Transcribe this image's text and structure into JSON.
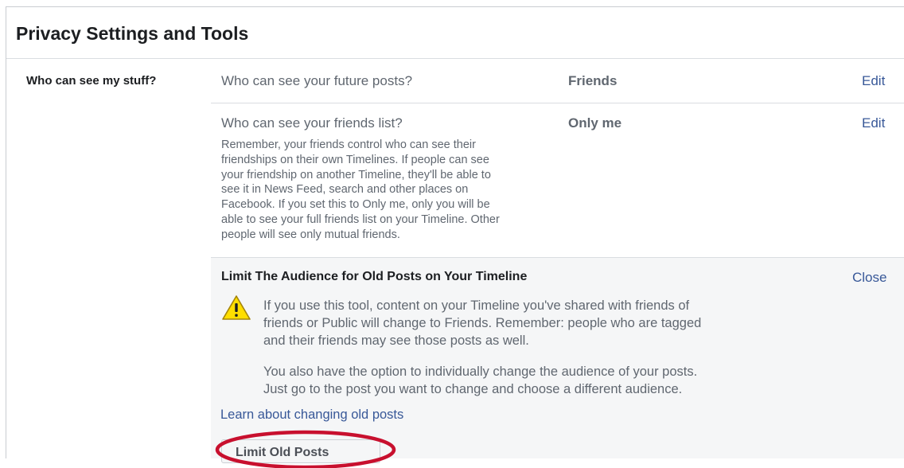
{
  "header": {
    "title": "Privacy Settings and Tools"
  },
  "section": {
    "label": "Who can see my stuff?"
  },
  "rows": [
    {
      "question": "Who can see your future posts?",
      "value": "Friends",
      "action": "Edit"
    },
    {
      "question": "Who can see your friends list?",
      "value": "Only me",
      "action": "Edit",
      "description_lines": [
        "Remember, your friends control who can see their",
        "friendships on their own Timelines. If people can see",
        "your friendship on another Timeline, they'll be able to",
        "see it in News Feed, search and other places on",
        "Facebook. If you set this to Only me, only you will be",
        "able to see your full friends list on your Timeline. Other",
        "people will see only mutual friends."
      ]
    }
  ],
  "panel": {
    "title": "Limit The Audience for Old Posts on Your Timeline",
    "close_label": "Close",
    "warning_icon": "warning-triangle-icon",
    "paragraph1_lines": [
      "If you use this tool, content on your Timeline you've shared with friends of",
      "friends or Public will change to Friends. Remember: people who are tagged",
      "and their friends may see those posts as well."
    ],
    "paragraph2_lines": [
      "You also have the option to individually change the audience of your posts.",
      "Just go to the post you want to change and choose a different audience."
    ],
    "learn_link": "Learn about changing old posts",
    "button_label": "Limit Old Posts"
  },
  "colors": {
    "link": "#385898",
    "muted_text": "#606770",
    "panel_bg": "#f5f6f7",
    "highlight": "#c8102e",
    "warning": "#ffde00"
  }
}
